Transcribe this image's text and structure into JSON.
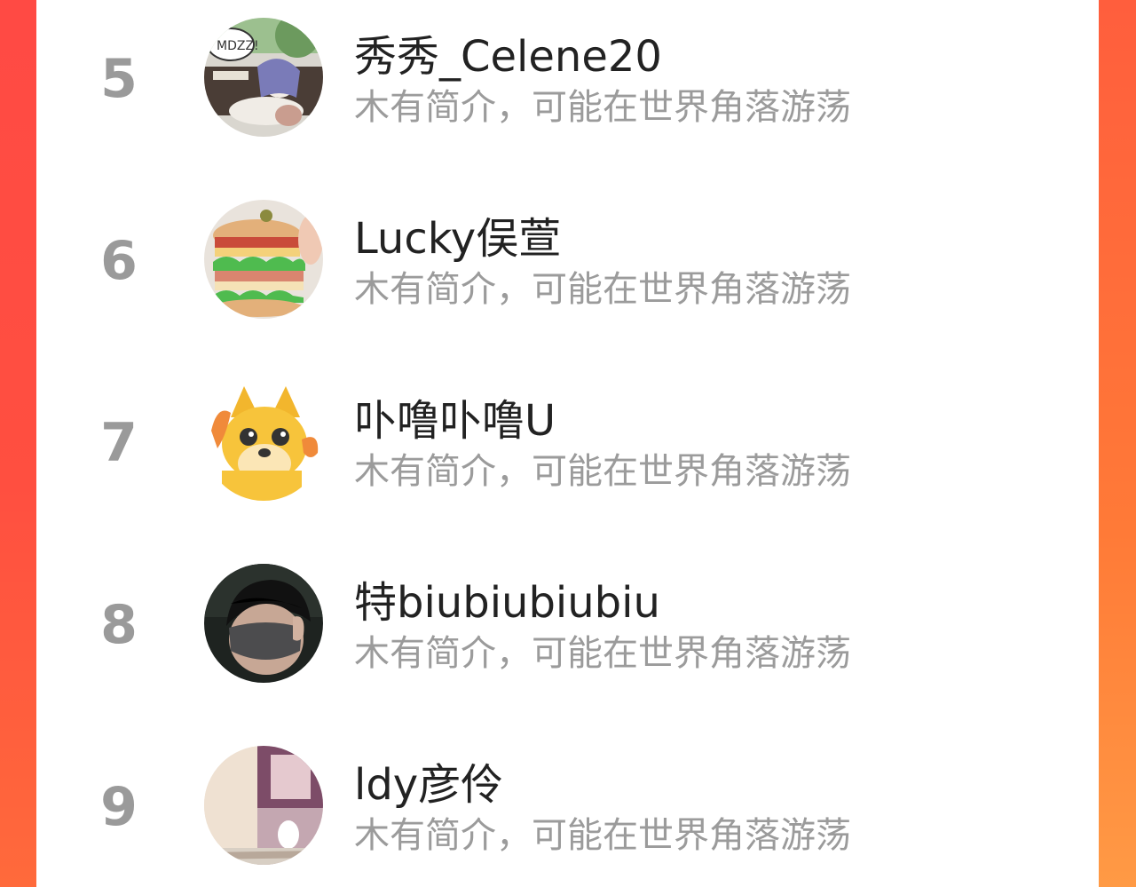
{
  "colors": {
    "rank": "#9a9a9a",
    "name": "#222222",
    "bio": "#9b9b9b",
    "accent": "#ff5640"
  },
  "list": [
    {
      "rank": "5",
      "name": "秀秀_Celene20",
      "bio": "木有简介，可能在世界角落游荡",
      "avatar_icon": "anime-character-avatar"
    },
    {
      "rank": "6",
      "name": "Lucky俣萱",
      "bio": "木有简介，可能在世界角落游荡",
      "avatar_icon": "sandwich-avatar"
    },
    {
      "rank": "7",
      "name": "卟噜卟噜U",
      "bio": "木有简介，可能在世界角落游荡",
      "avatar_icon": "shiba-dog-avatar"
    },
    {
      "rank": "8",
      "name": "特biubiubiubiu",
      "bio": "木有简介，可能在世界角落游荡",
      "avatar_icon": "masked-person-avatar"
    },
    {
      "rank": "9",
      "name": "ldy彦伶",
      "bio": "木有简介，可能在世界角落游荡",
      "avatar_icon": "photo-avatar"
    }
  ]
}
